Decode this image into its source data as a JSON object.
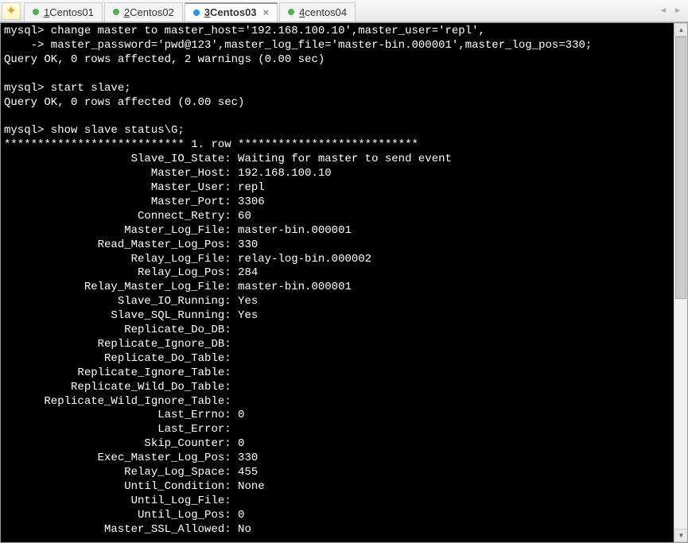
{
  "tabs": {
    "add_icon": "✦",
    "items": [
      {
        "num": "1",
        "label": "Centos01",
        "dot": "green",
        "active": false
      },
      {
        "num": "2",
        "label": "Centos02",
        "dot": "green",
        "active": false
      },
      {
        "num": "3",
        "label": "Centos03",
        "dot": "blue",
        "active": true
      },
      {
        "num": "4",
        "label": "centos04",
        "dot": "green",
        "active": false
      }
    ],
    "close_glyph": "×",
    "nav_left": "◄",
    "nav_right": "►"
  },
  "terminal": {
    "lines_pre": [
      "mysql> change master to master_host='192.168.100.10',master_user='repl',",
      "    -> master_password='pwd@123',master_log_file='master-bin.000001',master_log_pos=330;",
      "Query OK, 0 rows affected, 2 warnings (0.00 sec)",
      "",
      "mysql> start slave;",
      "Query OK, 0 rows affected (0.00 sec)",
      "",
      "mysql> show slave status\\G;",
      "*************************** 1. row ***************************"
    ],
    "status": [
      {
        "k": "Slave_IO_State",
        "v": "Waiting for master to send event"
      },
      {
        "k": "Master_Host",
        "v": "192.168.100.10"
      },
      {
        "k": "Master_User",
        "v": "repl"
      },
      {
        "k": "Master_Port",
        "v": "3306"
      },
      {
        "k": "Connect_Retry",
        "v": "60"
      },
      {
        "k": "Master_Log_File",
        "v": "master-bin.000001"
      },
      {
        "k": "Read_Master_Log_Pos",
        "v": "330"
      },
      {
        "k": "Relay_Log_File",
        "v": "relay-log-bin.000002"
      },
      {
        "k": "Relay_Log_Pos",
        "v": "284"
      },
      {
        "k": "Relay_Master_Log_File",
        "v": "master-bin.000001"
      },
      {
        "k": "Slave_IO_Running",
        "v": "Yes"
      },
      {
        "k": "Slave_SQL_Running",
        "v": "Yes"
      },
      {
        "k": "Replicate_Do_DB",
        "v": ""
      },
      {
        "k": "Replicate_Ignore_DB",
        "v": ""
      },
      {
        "k": "Replicate_Do_Table",
        "v": ""
      },
      {
        "k": "Replicate_Ignore_Table",
        "v": ""
      },
      {
        "k": "Replicate_Wild_Do_Table",
        "v": ""
      },
      {
        "k": "Replicate_Wild_Ignore_Table",
        "v": ""
      },
      {
        "k": "Last_Errno",
        "v": "0"
      },
      {
        "k": "Last_Error",
        "v": ""
      },
      {
        "k": "Skip_Counter",
        "v": "0"
      },
      {
        "k": "Exec_Master_Log_Pos",
        "v": "330"
      },
      {
        "k": "Relay_Log_Space",
        "v": "455"
      },
      {
        "k": "Until_Condition",
        "v": "None"
      },
      {
        "k": "Until_Log_File",
        "v": ""
      },
      {
        "k": "Until_Log_Pos",
        "v": "0"
      },
      {
        "k": "Master_SSL_Allowed",
        "v": "No"
      }
    ]
  }
}
